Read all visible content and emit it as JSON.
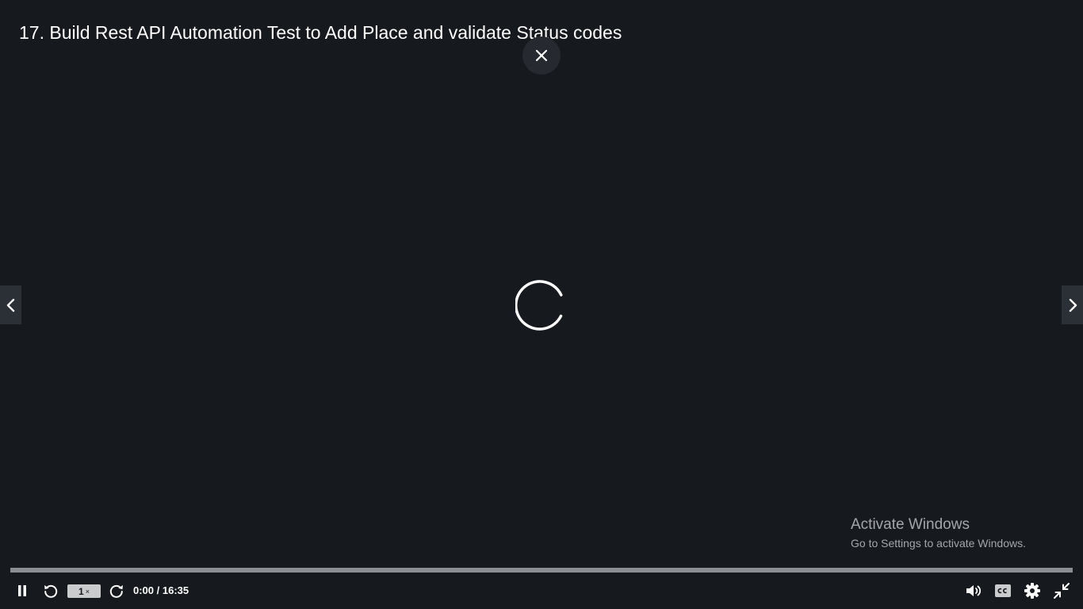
{
  "title": "17. Build Rest API Automation Test to Add Place and validate Status codes",
  "icons": {
    "close": "close-icon",
    "spinner": "loading-spinner-icon",
    "prev": "chevron-left-icon",
    "next": "chevron-right-icon",
    "play_pause": "pause-icon",
    "rewind": "rewind-icon",
    "forward": "forward-icon",
    "volume": "volume-icon",
    "captions": "closed-captions-icon",
    "settings": "gear-icon",
    "exit_fullscreen": "exit-fullscreen-icon"
  },
  "controls": {
    "speed_value": "1",
    "speed_suffix": "×",
    "current_time": "0:00",
    "duration": "16:35",
    "time_separator": " / ",
    "progress_fraction": 0
  },
  "watermark": {
    "title": "Activate Windows",
    "subtitle": "Go to Settings to activate Windows."
  },
  "colors": {
    "background": "#16191e",
    "progress_track": "#8a8d91",
    "text": "#ffffff"
  }
}
